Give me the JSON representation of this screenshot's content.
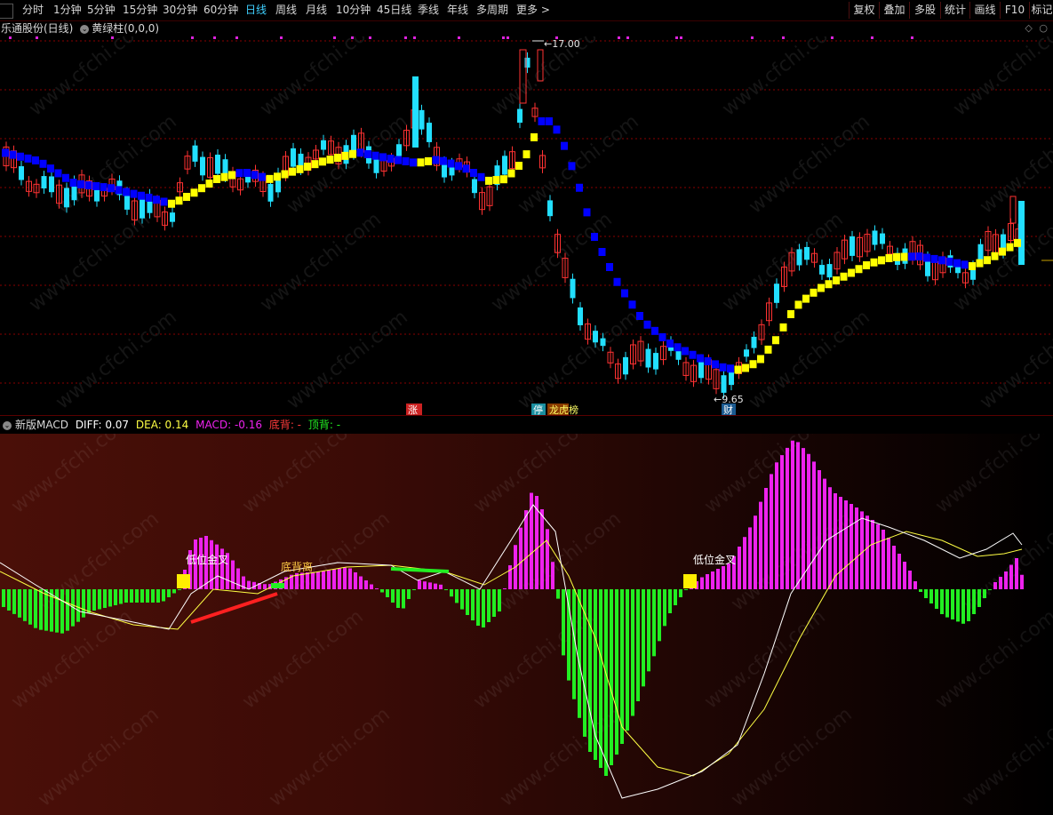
{
  "toolbar": {
    "periods": [
      "分时",
      "1分钟",
      "5分钟",
      "15分钟",
      "30分钟",
      "60分钟",
      "日线",
      "周线",
      "月线",
      "10分钟",
      "45日线",
      "季线",
      "年线",
      "多周期",
      "更多 >"
    ],
    "active_period": "日线",
    "right_buttons": [
      "复权",
      "叠加",
      "多股",
      "统计",
      "画线",
      "F10",
      "标记"
    ]
  },
  "info": {
    "stock_name": "乐通股份(日线)",
    "indicator": "黄绿柱(0,0,0)"
  },
  "main_chart": {
    "high_label": "17.00",
    "low_label": "9.65",
    "event_badges": [
      "涨",
      "停",
      "龙虎榜",
      "财"
    ],
    "colors": {
      "up": "#ff3232",
      "down": "#22dfff",
      "line_up": "#ffff00",
      "line_down": "#0000ff",
      "grid": "#8a0000"
    }
  },
  "macd": {
    "name": "新版MACD",
    "diff_label": "DIFF: 0.07",
    "dea_label": "DEA: 0.14",
    "macd_label": "MACD: -0.16",
    "bottom_div_label": "底背: -",
    "top_div_label": "顶背: -",
    "annotations": [
      "低位金叉",
      "底背离",
      "低位金叉"
    ],
    "colors": {
      "pos": "#ee22ee",
      "neg": "#22ee22",
      "diff": "#ffffff",
      "dea": "#ffff44"
    }
  },
  "watermark": "www.cfchi.com"
}
